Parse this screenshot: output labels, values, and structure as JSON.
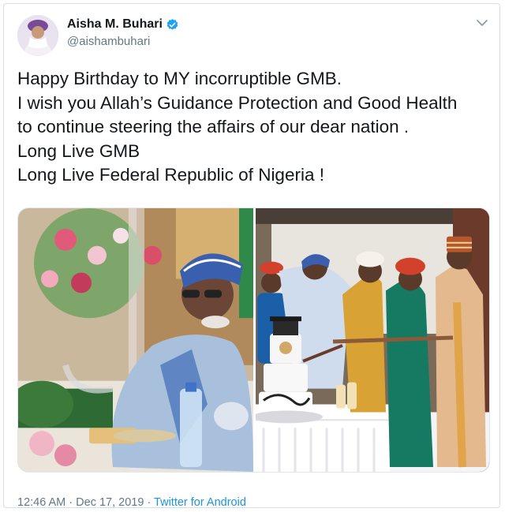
{
  "user": {
    "display_name": "Aisha M. Buhari",
    "handle": "@aishambuhari",
    "avatar_icon": "profile-avatar",
    "verified_icon": "verified-badge-icon",
    "verified_color": "#1da1f2"
  },
  "tweet": {
    "lines": [
      "Happy Birthday to MY incorruptible GMB.",
      "I wish you Allah’s Guidance Protection and Good Health",
      "to continue steering the affairs of our dear nation .",
      "Long Live GMB",
      "Long Live Federal Republic of Nigeria !"
    ]
  },
  "footer": {
    "time": "12:46 AM",
    "separator": " · ",
    "date": "Dec 17, 2019",
    "separator2": " · ",
    "source": "Twitter for Android"
  },
  "colors": {
    "link": "#1b95e0",
    "secondary_text": "#657786",
    "border": "#d8dde2"
  }
}
